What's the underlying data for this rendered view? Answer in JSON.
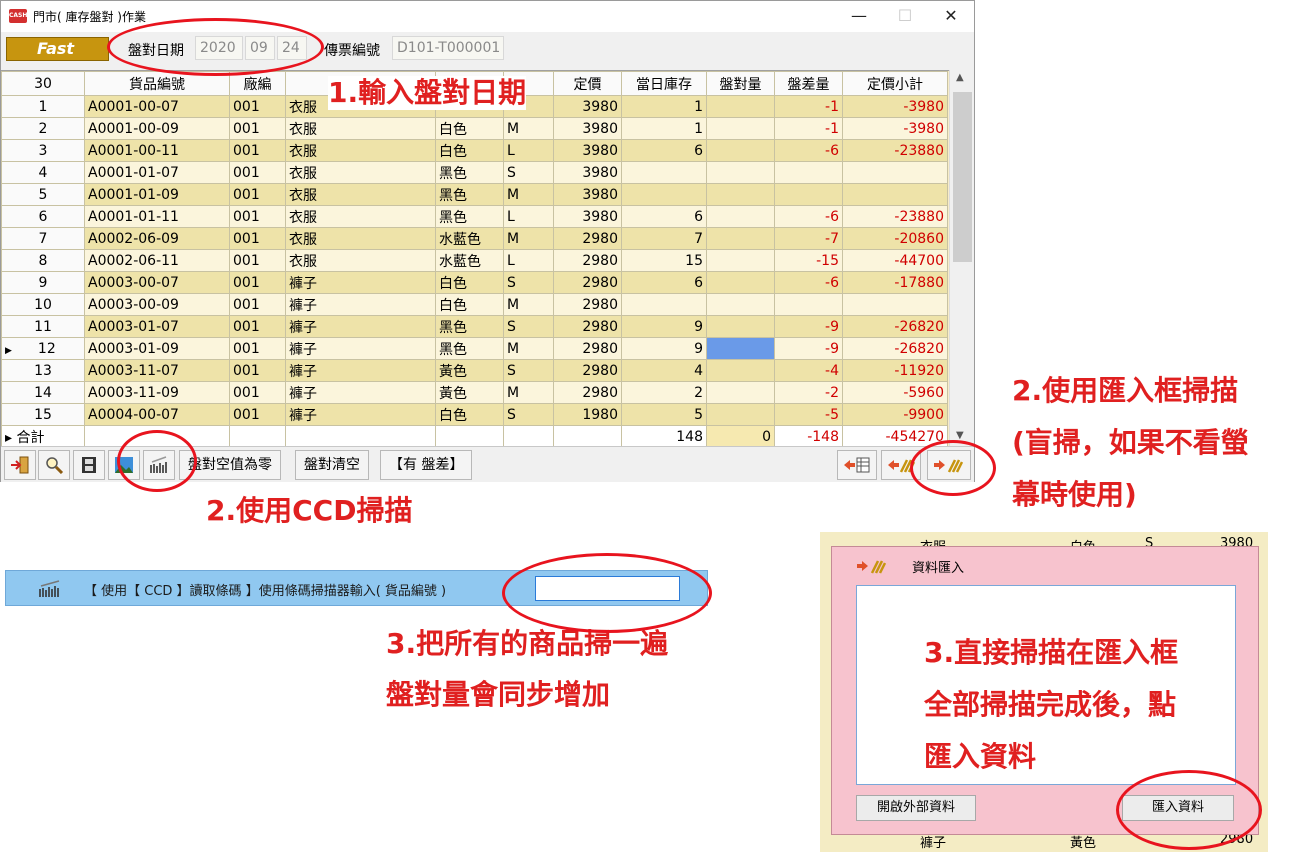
{
  "window": {
    "title": "門市( 庫存盤對 )作業",
    "logo": "Fast",
    "app_icon": "CASH",
    "minimize": "—",
    "maximize": "☐",
    "close": "✕"
  },
  "header": {
    "date_label": "盤對日期",
    "year": "2020",
    "month": "09",
    "day": "24",
    "doc_label": "傳票編號",
    "doc_number": "D101-T000001"
  },
  "grid": {
    "row_count": "30",
    "columns": [
      "貨品編號",
      "廠編",
      "",
      "",
      "",
      "定價",
      "當日庫存",
      "盤對量",
      "盤差量",
      "定價小計"
    ],
    "rows": [
      {
        "n": "1",
        "code": "A0001-00-07",
        "vendor": "001",
        "cat": "衣服",
        "color": "",
        "size": "",
        "price": "3980",
        "stock": "1",
        "count": "",
        "diff": "-1",
        "subtotal": "-3980"
      },
      {
        "n": "2",
        "code": "A0001-00-09",
        "vendor": "001",
        "cat": "衣服",
        "color": "白色",
        "size": "M",
        "price": "3980",
        "stock": "1",
        "count": "",
        "diff": "-1",
        "subtotal": "-3980"
      },
      {
        "n": "3",
        "code": "A0001-00-11",
        "vendor": "001",
        "cat": "衣服",
        "color": "白色",
        "size": "L",
        "price": "3980",
        "stock": "6",
        "count": "",
        "diff": "-6",
        "subtotal": "-23880"
      },
      {
        "n": "4",
        "code": "A0001-01-07",
        "vendor": "001",
        "cat": "衣服",
        "color": "黑色",
        "size": "S",
        "price": "3980",
        "stock": "",
        "count": "",
        "diff": "",
        "subtotal": ""
      },
      {
        "n": "5",
        "code": "A0001-01-09",
        "vendor": "001",
        "cat": "衣服",
        "color": "黑色",
        "size": "M",
        "price": "3980",
        "stock": "",
        "count": "",
        "diff": "",
        "subtotal": ""
      },
      {
        "n": "6",
        "code": "A0001-01-11",
        "vendor": "001",
        "cat": "衣服",
        "color": "黑色",
        "size": "L",
        "price": "3980",
        "stock": "6",
        "count": "",
        "diff": "-6",
        "subtotal": "-23880"
      },
      {
        "n": "7",
        "code": "A0002-06-09",
        "vendor": "001",
        "cat": "衣服",
        "color": "水藍色",
        "size": "M",
        "price": "2980",
        "stock": "7",
        "count": "",
        "diff": "-7",
        "subtotal": "-20860"
      },
      {
        "n": "8",
        "code": "A0002-06-11",
        "vendor": "001",
        "cat": "衣服",
        "color": "水藍色",
        "size": "L",
        "price": "2980",
        "stock": "15",
        "count": "",
        "diff": "-15",
        "subtotal": "-44700"
      },
      {
        "n": "9",
        "code": "A0003-00-07",
        "vendor": "001",
        "cat": "褲子",
        "color": "白色",
        "size": "S",
        "price": "2980",
        "stock": "6",
        "count": "",
        "diff": "-6",
        "subtotal": "-17880"
      },
      {
        "n": "10",
        "code": "A0003-00-09",
        "vendor": "001",
        "cat": "褲子",
        "color": "白色",
        "size": "M",
        "price": "2980",
        "stock": "",
        "count": "",
        "diff": "",
        "subtotal": ""
      },
      {
        "n": "11",
        "code": "A0003-01-07",
        "vendor": "001",
        "cat": "褲子",
        "color": "黑色",
        "size": "S",
        "price": "2980",
        "stock": "9",
        "count": "",
        "diff": "-9",
        "subtotal": "-26820"
      },
      {
        "n": "12",
        "code": "A0003-01-09",
        "vendor": "001",
        "cat": "褲子",
        "color": "黑色",
        "size": "M",
        "price": "2980",
        "stock": "9",
        "count": "",
        "diff": "-9",
        "subtotal": "-26820"
      },
      {
        "n": "13",
        "code": "A0003-11-07",
        "vendor": "001",
        "cat": "褲子",
        "color": "黃色",
        "size": "S",
        "price": "2980",
        "stock": "4",
        "count": "",
        "diff": "-4",
        "subtotal": "-11920"
      },
      {
        "n": "14",
        "code": "A0003-11-09",
        "vendor": "001",
        "cat": "褲子",
        "color": "黃色",
        "size": "M",
        "price": "2980",
        "stock": "2",
        "count": "",
        "diff": "-2",
        "subtotal": "-5960"
      },
      {
        "n": "15",
        "code": "A0004-00-07",
        "vendor": "001",
        "cat": "褲子",
        "color": "白色",
        "size": "S",
        "price": "1980",
        "stock": "5",
        "count": "",
        "diff": "-5",
        "subtotal": "-9900"
      }
    ],
    "selected_row": "12",
    "total": {
      "label": "合計",
      "stock": "148",
      "count": "0",
      "diff": "-148",
      "subtotal": "-454270"
    }
  },
  "toolbar": {
    "zero_label": "盤對空值為零",
    "clear_label": "盤對清空",
    "filter_label": "【有 盤差】",
    "icons": [
      "exit-icon",
      "search-icon",
      "film-icon",
      "picture-icon",
      "barcode-scanner-icon",
      "export-sheet-icon",
      "back-arrows-icon",
      "import-arrows-icon"
    ]
  },
  "ccd": {
    "text": "【 使用【 CCD 】讀取條碼 】使用條碼掃描器輸入( 貨品編號 )",
    "input_value": ""
  },
  "dialog": {
    "title": "資料匯入",
    "text_value": "",
    "open_label": "開啟外部資料",
    "import_label": "匯入資料",
    "bg_partial": [
      "衣服",
      "白色",
      "S",
      "3980",
      "褲子",
      "黃色",
      "2980"
    ]
  },
  "annotations": {
    "a1": "1.輸入盤對日期",
    "a2_ccd": "2.使用CCD掃描",
    "a2_import_1": "2.使用匯入框掃描",
    "a2_import_2": "(盲掃，如果不看螢",
    "a2_import_3": "幕時使用)",
    "a3_left_1": "3.把所有的商品掃一遍",
    "a3_left_2": "盤對量會同步增加",
    "a3_right_1": "3.直接掃描在匯入框",
    "a3_right_2": "全部掃描完成後，點",
    "a3_right_3": "匯入資料"
  },
  "colors": {
    "accent_red": "#e02020",
    "grid_even": "#eee3a9",
    "grid_odd": "#fbf5dc",
    "selected_cell": "#6a9ae8",
    "ccd_bar": "#90c8f0",
    "dialog_bg": "#f7c3ce"
  }
}
